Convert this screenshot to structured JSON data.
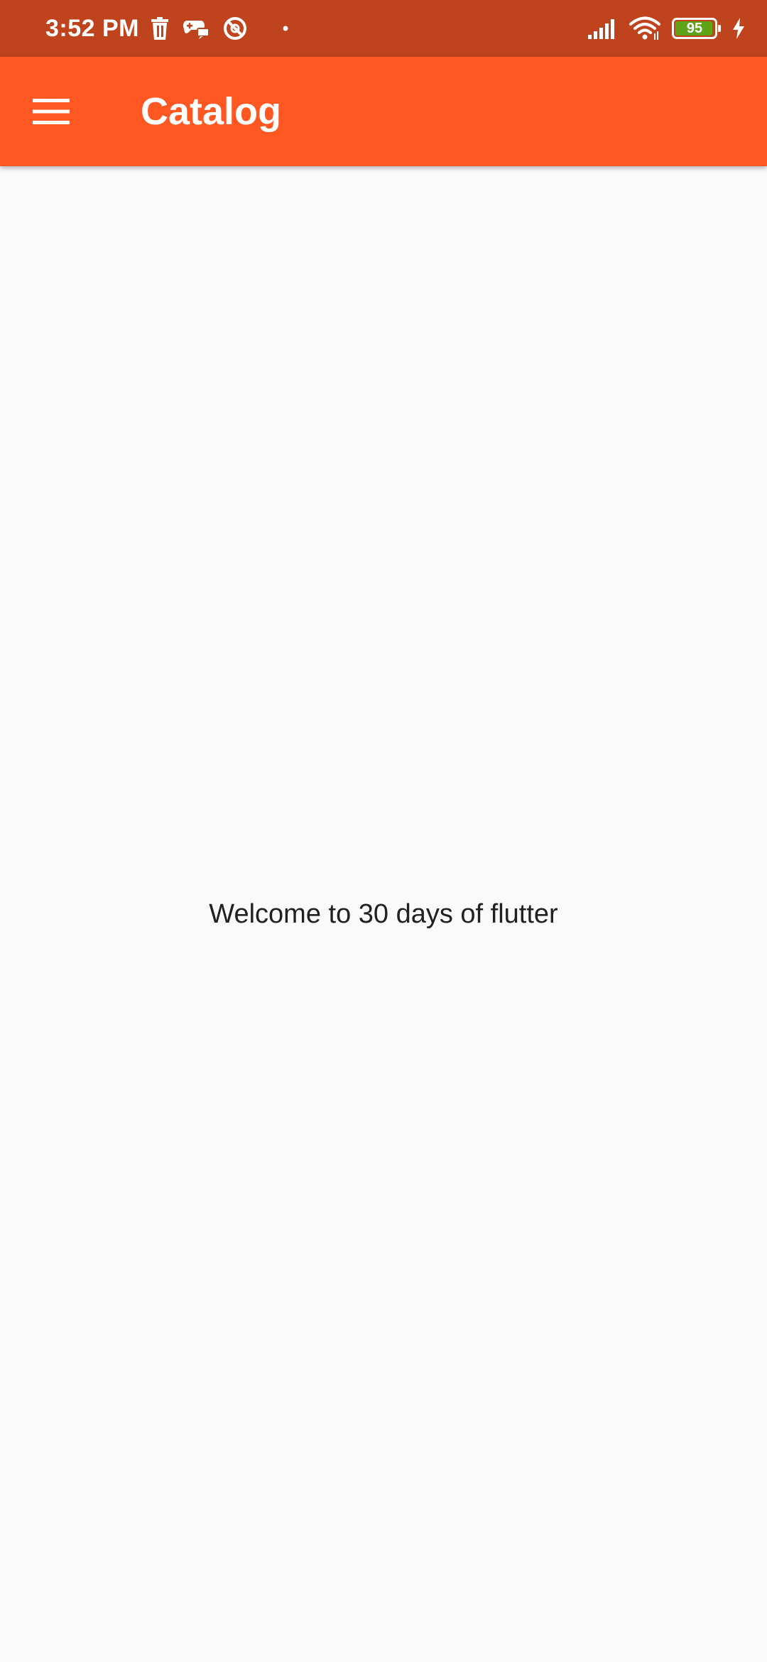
{
  "status_bar": {
    "time": "3:52 PM",
    "battery_level": "95",
    "left_icons": [
      "trash-icon",
      "game-controller-chat-icon",
      "blocked-circle-icon",
      "dot-icon"
    ],
    "right_icons": [
      "signal-icon",
      "wifi-icon",
      "battery-icon",
      "charging-bolt-icon"
    ],
    "background_color": "#bf431c"
  },
  "app_bar": {
    "title": "Catalog",
    "menu_icon": "hamburger-menu-icon",
    "background_color": "#ff5722"
  },
  "body": {
    "message": "Welcome to 30 days of flutter",
    "background_color": "#fafafa"
  }
}
